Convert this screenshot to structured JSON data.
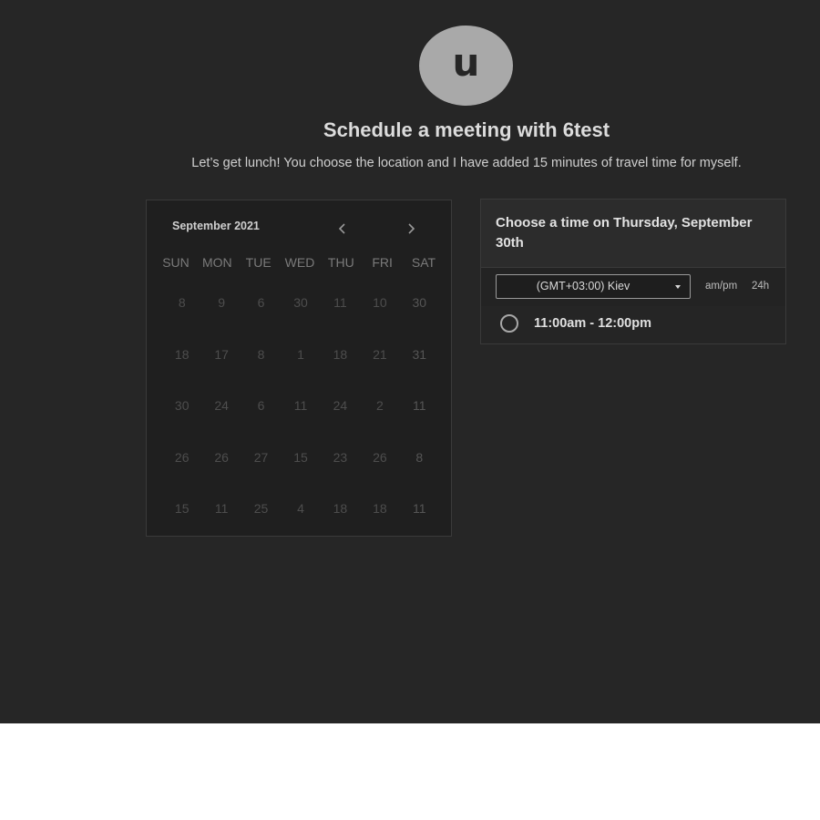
{
  "host": {
    "avatar_initial": "u",
    "title": "Schedule a meeting with 6test",
    "description": "Let’s get lunch! You choose the location and I have added 15 minutes of travel time for myself."
  },
  "calendar": {
    "month_label": "September 2021",
    "prev_icon": "chevron-left-icon",
    "next_icon": "chevron-right-icon",
    "weekdays": [
      "SUN",
      "MON",
      "TUE",
      "WED",
      "THU",
      "FRI",
      "SAT"
    ],
    "days": [
      "8",
      "9",
      "6",
      "30",
      "11",
      "10",
      "30",
      "18",
      "17",
      "8",
      "1",
      "18",
      "21",
      "31",
      "30",
      "24",
      "6",
      "11",
      "24",
      "2",
      "11",
      "26",
      "26",
      "27",
      "15",
      "23",
      "26",
      "8",
      "15",
      "11",
      "25",
      "4",
      "18",
      "18",
      "11"
    ]
  },
  "time_panel": {
    "heading": "Choose a time on Thursday, September 30th",
    "timezone": "(GMT+03:00) Kiev",
    "format_ampm": "am/pm",
    "format_24h": "24h",
    "slots": [
      "11:00am - 12:00pm"
    ]
  },
  "colors": {
    "background": "#262626",
    "calendar_bg": "#1f1f1f",
    "panel_bg": "#2c2c2c",
    "avatar": "#a9a9a9"
  }
}
